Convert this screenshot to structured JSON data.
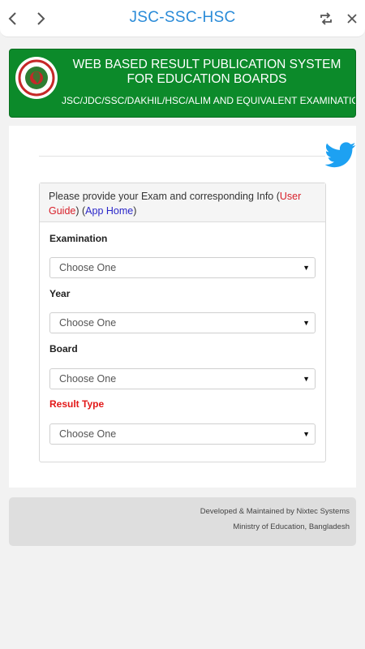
{
  "topbar": {
    "title": "JSC-SSC-HSC",
    "back_icon": "chevron-left-icon",
    "forward_icon": "chevron-right-icon",
    "refresh_icon": "refresh-icon",
    "close_icon": "close-icon"
  },
  "banner": {
    "title": "WEB BASED RESULT PUBLICATION SYSTEM FOR EDUCATION BOARDS",
    "subtitle": "JSC/JDC/SSC/DAKHIL/HSC/ALIM AND EQUIVALENT EXAMINATION",
    "background_color": "#0c8a2a",
    "logo_icon": "government-seal-icon"
  },
  "form": {
    "intro_text": "Please provide your Exam and corresponding Info (",
    "user_guide_link": "User Guide",
    "mid_text": ") (",
    "app_home_link": "App Home",
    "end_text": ")",
    "fields": [
      {
        "label": "Examination",
        "value": "Choose One"
      },
      {
        "label": "Year",
        "value": "Choose One"
      },
      {
        "label": "Board",
        "value": "Choose One"
      },
      {
        "label": "Result Type",
        "value": "Choose One"
      }
    ],
    "caret_glyph": "▼"
  },
  "footer": {
    "line1": "Developed & Maintained by Nixtec Systems",
    "line2": "Ministry of Education, Bangladesh"
  },
  "colors": {
    "accent_blue": "#2a8bd8",
    "banner_green": "#0c8a2a",
    "link_red": "#d8202a",
    "link_blue": "#2a26c9",
    "result_type_red": "#e21818",
    "twitter_blue": "#1da1f2"
  }
}
